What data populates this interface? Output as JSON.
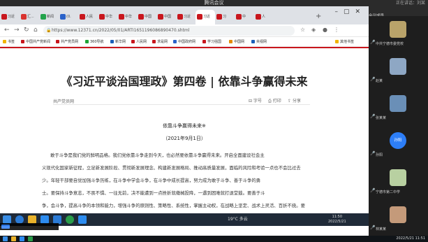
{
  "meeting": {
    "title": "腾讯会议",
    "status": "正在讲话：刘某"
  },
  "browser": {
    "tabs": [
      "习近",
      "汇...",
      "新闻",
      "(0.",
      "人民",
      "中华",
      "中华",
      "中国",
      "中国",
      "习近",
      "习近",
      "习",
      "中",
      "人"
    ],
    "url": "https://www.12371.cn/2022/05/01/ARTI1651196086890470.shtml",
    "bookmarks": [
      "书签",
      "中国共产党新闻",
      "共产党员网",
      "360导航",
      "新华网",
      "人民网",
      "求是网",
      "中国政府网",
      "学习强国",
      "中国网",
      "央视网",
      "其他书签"
    ]
  },
  "article": {
    "headline": "《习近平谈治国理政》第四卷 | 依靠斗争赢得未来",
    "source": "共产党员网",
    "actions": [
      "字号",
      "打印",
      "分享"
    ],
    "subtitle": "依靠斗争赢得未来※",
    "date": "（2021年9月1日）",
    "paragraphs": [
      "敢于斗争是我们党的鲜明品格。我们党依靠斗争走到今天，也必然要依靠斗争赢得未来。开启全面建设社会主",
      "义现代化国家新征程，立足新发展阶段、贯彻新发展理念、构建新发展格局、推动高质量发展，面临的风险和考验一点也不会比过去",
      "少。年轻干部要自觉加强斗争历练，在斗争中学会斗争，在斗争中成长提高，努力成为敢于斗争、善于斗争的勇",
      "士。要保持斗争意志，不畏不惧、一往无前，决不能遭到一点挫折就缴械投降，一遇到困难就打退堂鼓。要善于斗",
      "争，会斗争，提高斗争的本领和能力，增强斗争的原则性、策略性、系统性，掌握主动权，在战略上坚定、战术上灵活、百折不挠。要"
    ]
  },
  "taskbar": {
    "weather": "19°C 多云",
    "time": "11:50",
    "date": "2022/5/21"
  },
  "share": {
    "label": "您正在共享屏幕"
  },
  "panel": {
    "label": "会议成员"
  },
  "participants": [
    {
      "name": "中共宁德市委党校",
      "color": "#b9a36a"
    },
    {
      "name": "赵某",
      "color": "#8ea7c4"
    },
    {
      "name": "张某某",
      "color": "#6a8fb7"
    },
    {
      "name": "孙阳",
      "color": "#2d7ef7"
    },
    {
      "name": "宁德市第二中学",
      "color": "#b8d0a1"
    },
    {
      "name": "林某某",
      "color": "#c49a7a"
    }
  ],
  "avatar_text": {
    "sun": "孙阳"
  },
  "bottom_clock": "2022/5/21 11:51"
}
